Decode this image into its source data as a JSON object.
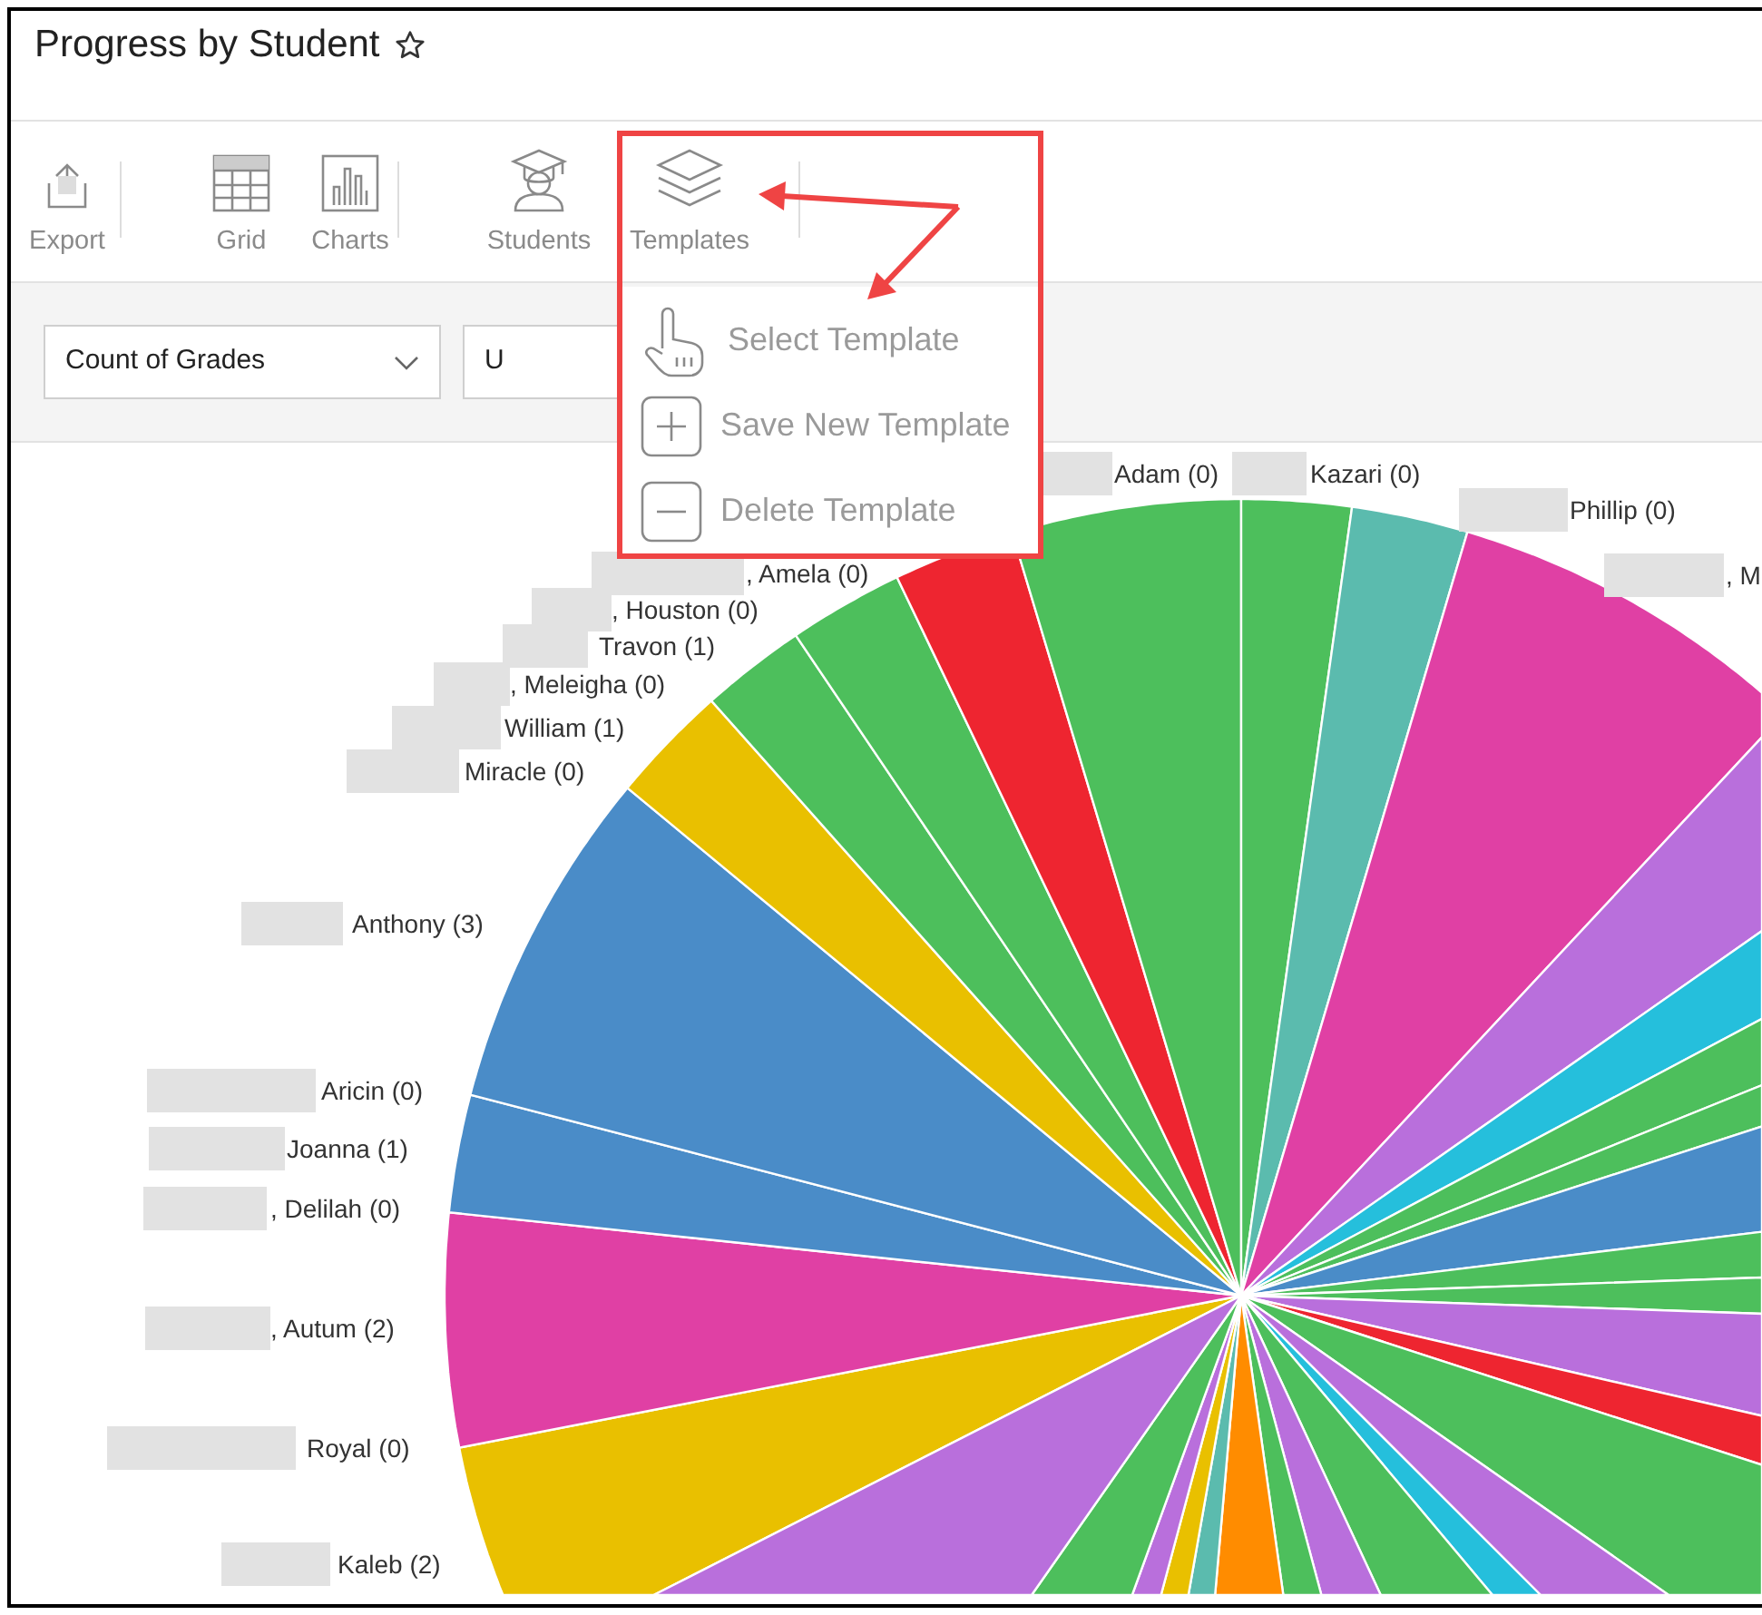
{
  "title": "Progress by Student",
  "toolbar": [
    {
      "label": "Export",
      "kind": "export"
    },
    {
      "label": "Grid",
      "kind": "grid"
    },
    {
      "label": "Charts",
      "kind": "charts"
    },
    {
      "label": "Students",
      "kind": "students"
    },
    {
      "label": "Templates",
      "kind": "templates"
    }
  ],
  "template_menu": [
    {
      "label": "Select Template",
      "kind": "select"
    },
    {
      "label": "Save New Template",
      "kind": "add"
    },
    {
      "label": "Delete Template",
      "kind": "delete"
    }
  ],
  "filters": {
    "measure": {
      "value": "Count of Grades"
    },
    "field": {
      "value": "U"
    }
  },
  "chart_labels": [
    "Adam (0)",
    "Kazari (0)",
    "Phillip (0)",
    ", M",
    ", Amela (0)",
    ", Houston (0)",
    "Travon (1)",
    ", Meleigha (0)",
    "William (1)",
    "Miracle (0)",
    "Anthony (3)",
    "Aricin (0)",
    "Joanna (1)",
    ", Delilah (0)",
    ", Autum (2)",
    "Royal (0)",
    "Kaleb (2)"
  ]
}
